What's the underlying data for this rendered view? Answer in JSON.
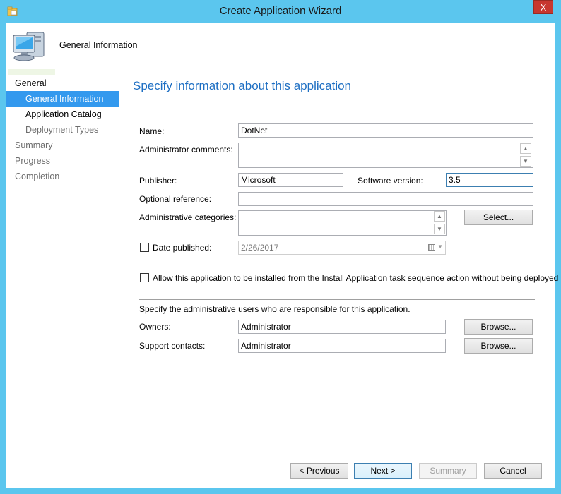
{
  "window": {
    "title": "Create Application Wizard",
    "close": "X"
  },
  "header": {
    "page_title": "General Information"
  },
  "nav": {
    "items": [
      {
        "label": "General"
      },
      {
        "label": "General Information"
      },
      {
        "label": "Application Catalog"
      },
      {
        "label": "Deployment Types"
      },
      {
        "label": "Summary"
      },
      {
        "label": "Progress"
      },
      {
        "label": "Completion"
      }
    ]
  },
  "main": {
    "heading": "Specify information about this application",
    "name": {
      "label": "Name:",
      "value": "DotNet"
    },
    "admin_comments": {
      "label": "Administrator comments:",
      "value": ""
    },
    "publisher": {
      "label": "Publisher:",
      "value": "Microsoft"
    },
    "software_version": {
      "label": "Software version:",
      "value": "3.5"
    },
    "optional_reference": {
      "label": "Optional reference:",
      "value": ""
    },
    "admin_categories": {
      "label": "Administrative categories:",
      "value": "",
      "select_label": "Select..."
    },
    "date_published": {
      "label": "Date published:",
      "value": "2/26/2017",
      "checked": false
    },
    "allow_install": {
      "label": "Allow this application to be installed from the Install Application task sequence action without being deployed",
      "checked": false
    },
    "responsible_text": "Specify the administrative users who are responsible for this application.",
    "owners": {
      "label": "Owners:",
      "value": "Administrator",
      "browse_label": "Browse..."
    },
    "support_contacts": {
      "label": "Support contacts:",
      "value": "Administrator",
      "browse_label": "Browse..."
    }
  },
  "footer": {
    "previous": "< Previous",
    "next": "Next >",
    "summary": "Summary",
    "cancel": "Cancel"
  },
  "colors": {
    "frame": "#5bc6ee",
    "accent": "#3399ee",
    "heading": "#1e6fc3",
    "close": "#c7372f"
  }
}
